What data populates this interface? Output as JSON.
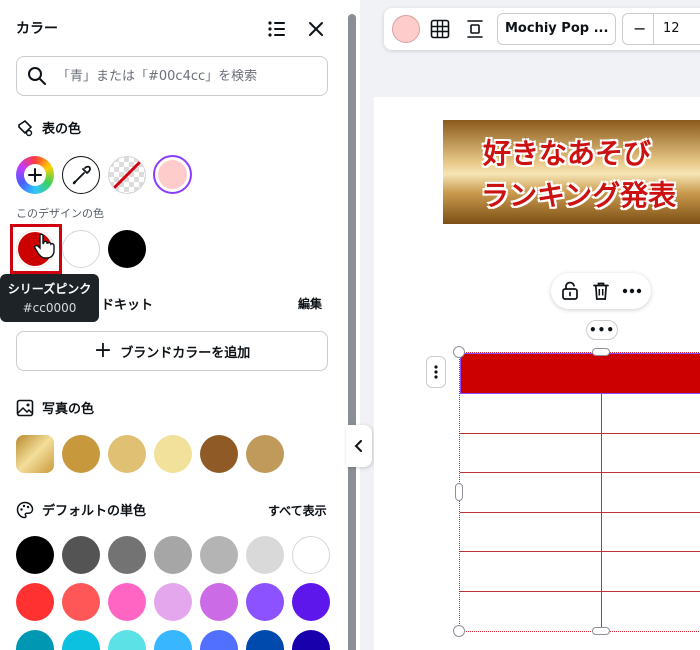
{
  "panel": {
    "title": "カラー",
    "search_placeholder": "「青」または「#00c4cc」を検索",
    "document_colors": {
      "label": "表の色",
      "swatches": [
        {
          "name": "add-color",
          "color": "#ffffff"
        },
        {
          "name": "eyedropper",
          "color": "#ffffff"
        },
        {
          "name": "no-color",
          "color": "#ffffff"
        },
        {
          "name": "current-color",
          "color": "#ffcccc"
        }
      ]
    },
    "design_colors": {
      "label": "このデザインの色",
      "swatches": [
        "#cc0000",
        "#ffffff",
        "#000000"
      ]
    },
    "tooltip": {
      "name": "シリーズピンク",
      "hex": "#cc0000"
    },
    "brand_kit": {
      "label": "ブランドキット",
      "visible_label": "ドキット",
      "edit_label": "編集",
      "add_button": "ブランドカラーを追加"
    },
    "photo_colors": {
      "label": "写真の色",
      "swatches": [
        "#d9b85a",
        "#c8983c",
        "#e0c072",
        "#f1e19a",
        "#8f5a26",
        "#c09a5a"
      ]
    },
    "default_colors": {
      "label": "デフォルトの単色",
      "show_all": "すべて表示",
      "rows": [
        [
          "#000000",
          "#545454",
          "#737373",
          "#a6a6a6",
          "#b4b4b4",
          "#d9d9d9",
          "#ffffff"
        ],
        [
          "#ff3131",
          "#ff5757",
          "#ff66c4",
          "#e4a7ee",
          "#cb6ce6",
          "#8c52ff",
          "#5e17eb"
        ],
        [
          "#0097b2",
          "#0cc0df",
          "#5ce1e6",
          "#38b6ff",
          "#5170ff",
          "#004aad",
          "#1800ad"
        ]
      ]
    }
  },
  "toolbar": {
    "color": "#ffcccc",
    "font_name": "Mochiy Pop ...",
    "font_size_minus": "−",
    "font_size": "12"
  },
  "canvas": {
    "banner_line1": "好きなあそび",
    "banner_line2": "ランキング発表",
    "table_header_color": "#cc0000",
    "dots_label": "•••"
  }
}
